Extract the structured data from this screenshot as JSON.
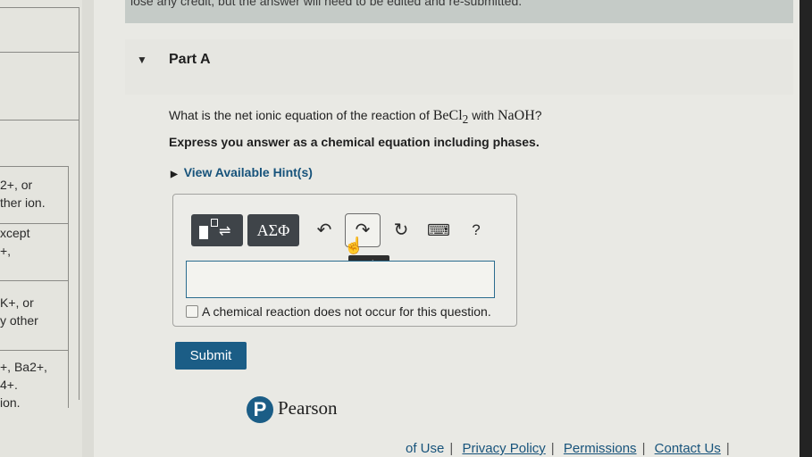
{
  "left_table": {
    "rows": [
      {
        "line1": "",
        "line2": ""
      },
      {
        "line1": "",
        "line2": ""
      },
      {
        "line1": "",
        "line2": ""
      },
      {
        "line1": "2+, or",
        "line2": "ther ion."
      },
      {
        "line1": "xcept",
        "line2": "+,"
      },
      {
        "line1": "K+, or",
        "line2": "y other"
      },
      {
        "line1": "+, Ba2+,",
        "line2": "4+.",
        "line3": "ion."
      }
    ]
  },
  "banner": {
    "text": "lose any credit, but the answer will need to be edited and re-submitted."
  },
  "part": {
    "title": "Part A"
  },
  "question": {
    "prefix": "What is the net ionic equation of the reaction of ",
    "reactant1": "BeCl",
    "reactant1_sub": "2",
    "middle": " with ",
    "reactant2": "NaOH",
    "suffix": "?"
  },
  "instruction": "Express you answer as a chemical equation including phases.",
  "hints": {
    "label": "View Available Hint(s)"
  },
  "toolbar": {
    "symbols_label": "ΑΣΦ",
    "help_label": "?",
    "redo_tooltip": "redo"
  },
  "answer": {
    "value": ""
  },
  "no_reaction": {
    "label": "A chemical reaction does not occur for this question.",
    "checked": false
  },
  "submit": {
    "label": "Submit"
  },
  "brand": {
    "logo_letter": "P",
    "name": "Pearson"
  },
  "footer": {
    "links": [
      "Privacy Policy",
      "Permissions",
      "Contact Us"
    ],
    "partial_left": "of Use"
  },
  "colors": {
    "accent": "#1b5d86",
    "link": "#17537b",
    "toolbar": "#3f4449"
  }
}
